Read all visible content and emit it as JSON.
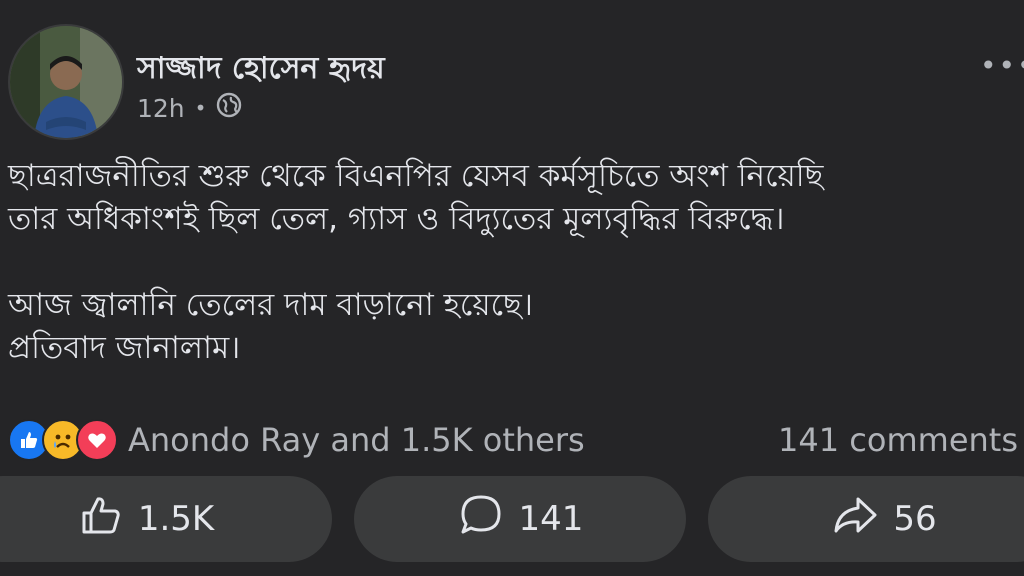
{
  "post": {
    "author": "সাজ্জাদ হোসেন হৃদয়",
    "time": "12h",
    "separator": "•",
    "more_menu": "•••",
    "privacy_icon": "globe-icon",
    "text_lines": [
      "ছাত্ররাজনীতির শুরু থেকে বিএনপির যেসব কর্মসূচিতে অংশ নিয়েছি",
      "তার অধিকাংশই ছিল তেল, গ্যাস ও বিদ্যুতের মূল্যবৃদ্ধির বিরুদ্ধে।",
      "",
      "আজ জ্বালানি তেলের দাম বাড়ানো হয়েছে।",
      "প্রতিবাদ জানালাম।"
    ]
  },
  "reactions": {
    "icons": [
      "like-reaction-icon",
      "sad-reaction-icon",
      "love-reaction-icon"
    ],
    "summary": "Anondo Ray and 1.5K others",
    "comments": "141 comments"
  },
  "actions": {
    "like_count": "1.5K",
    "comment_count": "141",
    "share_count": "56"
  },
  "colors": {
    "background": "#252527",
    "button_bg": "#3a3b3c",
    "text_primary": "#e4e6eb",
    "text_secondary": "#b0b3b8",
    "like_blue": "#1877f2",
    "sad_yellow": "#f7b928",
    "love_red": "#f33e58"
  }
}
